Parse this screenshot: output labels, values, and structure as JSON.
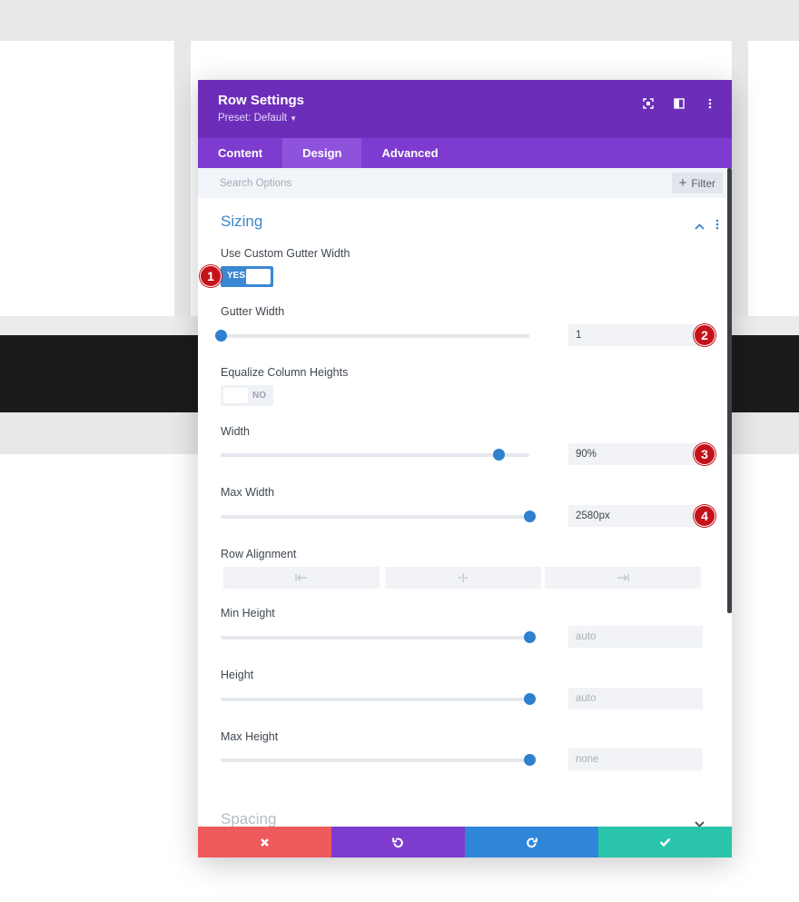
{
  "modal": {
    "title": "Row Settings",
    "preset_label": "Preset: Default"
  },
  "tabs": [
    {
      "label": "Content",
      "active": false
    },
    {
      "label": "Design",
      "active": true
    },
    {
      "label": "Advanced",
      "active": false
    }
  ],
  "search": {
    "placeholder": "Search Options"
  },
  "filter": {
    "label": "Filter"
  },
  "sizing": {
    "title": "Sizing",
    "use_custom_gutter": {
      "label": "Use Custom Gutter Width",
      "state": "YES"
    },
    "gutter_width": {
      "label": "Gutter Width",
      "value": "1",
      "slider_fraction": 0.0
    },
    "equalize_heights": {
      "label": "Equalize Column Heights",
      "state": "NO"
    },
    "width": {
      "label": "Width",
      "value": "90%",
      "slider_fraction": 0.9
    },
    "max_width": {
      "label": "Max Width",
      "value": "2580px",
      "slider_fraction": 1.0
    },
    "row_alignment": {
      "label": "Row Alignment"
    },
    "min_height": {
      "label": "Min Height",
      "value": "auto",
      "slider_fraction": 1.0
    },
    "height": {
      "label": "Height",
      "value": "auto",
      "slider_fraction": 1.0
    },
    "max_height": {
      "label": "Max Height",
      "value": "none",
      "slider_fraction": 1.0
    }
  },
  "spacing": {
    "title": "Spacing"
  },
  "badges": [
    "1",
    "2",
    "3",
    "4"
  ],
  "colors": {
    "header": "#6c2eb9",
    "tabs": "#7e3bd0",
    "accent_blue": "#2f80d0",
    "badge_red": "#c4121b",
    "cancel": "#ef5a5d",
    "undo": "#7d3cce",
    "redo": "#2f86d9",
    "save": "#29c4a9"
  },
  "icons": {
    "header": [
      "focus-icon",
      "split-view-icon",
      "more-vertical-icon"
    ],
    "footer": [
      "close-icon",
      "undo-icon",
      "redo-icon",
      "check-icon"
    ]
  }
}
